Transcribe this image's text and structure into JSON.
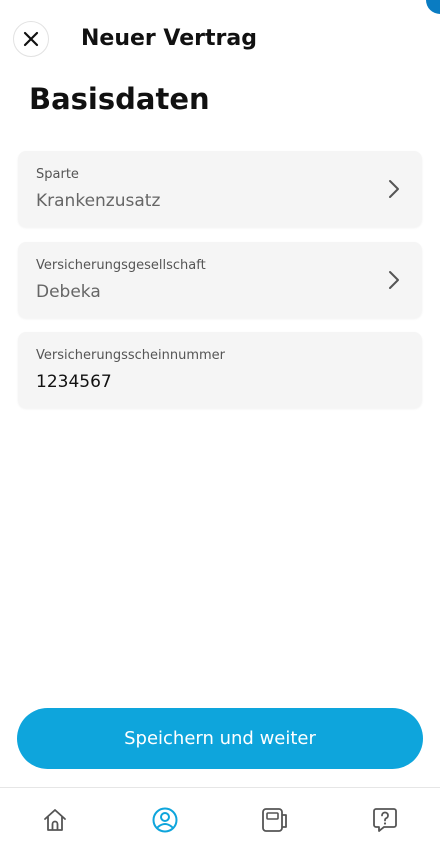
{
  "header": {
    "title": "Neuer Vertrag",
    "close_icon": "close-icon"
  },
  "page": {
    "title": "Basisdaten"
  },
  "fields": [
    {
      "label": "Sparte",
      "value": "Krankenzusatz",
      "has_chevron": true
    },
    {
      "label": "Versicherungsgesellschaft",
      "value": "Debeka",
      "has_chevron": true
    },
    {
      "label": "Versicherungsscheinnummer",
      "value": "1234567",
      "has_chevron": false
    }
  ],
  "actions": {
    "primary_label": "Speichern und weiter"
  },
  "bottom_nav": {
    "items": [
      {
        "icon": "home-icon",
        "active": false
      },
      {
        "icon": "profile-icon",
        "active": true
      },
      {
        "icon": "contract-icon",
        "active": false
      },
      {
        "icon": "help-icon",
        "active": false
      }
    ]
  },
  "colors": {
    "primary": "#0ea5dc",
    "accent_corner": "#0a7cc2",
    "field_bg": "#f5f5f5",
    "nav_inactive": "#555555"
  }
}
